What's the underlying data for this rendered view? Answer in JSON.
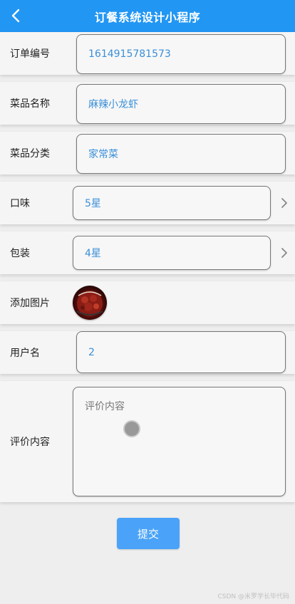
{
  "nav": {
    "title": "订餐系统设计小程序",
    "back_icon": "chevron-left-icon"
  },
  "form": {
    "order_no": {
      "label": "订单编号",
      "value": "1614915781573"
    },
    "dish_name": {
      "label": "菜品名称",
      "value": "麻辣小龙虾"
    },
    "dish_category": {
      "label": "菜品分类",
      "value": "家常菜"
    },
    "taste": {
      "label": "口味",
      "value": "5星"
    },
    "packaging": {
      "label": "包装",
      "value": "4星"
    },
    "image": {
      "label": "添加图片"
    },
    "username": {
      "label": "用户名",
      "value": "2"
    },
    "review": {
      "label": "评价内容",
      "placeholder": "评价内容"
    }
  },
  "submit": {
    "label": "提交"
  },
  "watermark": "CSDN @米罗学长毕代码",
  "colors": {
    "nav": "#2196f3",
    "accent": "#4aa3f8",
    "value_text": "#3a8fd8"
  }
}
